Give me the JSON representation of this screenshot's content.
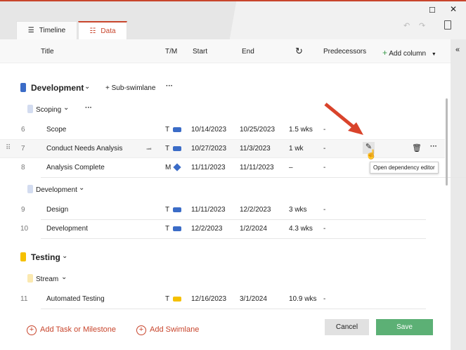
{
  "tabs": [
    {
      "label": "Timeline",
      "icon": "timeline-icon"
    },
    {
      "label": "Data",
      "icon": "list-icon",
      "active": true
    }
  ],
  "columns": {
    "title": "Title",
    "tm": "T/M",
    "start": "Start",
    "end": "End",
    "duration_icon": "history-icon",
    "predecessors": "Predecessors",
    "add_column": "Add column"
  },
  "groups": {
    "development": "Development",
    "sub_swimlane": "Sub-swimlane",
    "scoping": "Scoping",
    "development_sub": "Development",
    "testing": "Testing",
    "stream": "Stream"
  },
  "rows": [
    {
      "num": "6",
      "title": "Scope",
      "tm": "T",
      "start": "10/14/2023",
      "end": "10/25/2023",
      "duration": "1.5 wks",
      "pred": "-"
    },
    {
      "num": "7",
      "title": "Conduct Needs Analysis",
      "tm": "T",
      "start": "10/27/2023",
      "end": "11/3/2023",
      "duration": "1 wk",
      "pred": "-"
    },
    {
      "num": "8",
      "title": "Analysis Complete",
      "tm": "M",
      "start": "11/11/2023",
      "end": "11/11/2023",
      "duration": "–",
      "pred": "-"
    },
    {
      "num": "9",
      "title": "Design",
      "tm": "T",
      "start": "11/11/2023",
      "end": "12/2/2023",
      "duration": "3 wks",
      "pred": "-"
    },
    {
      "num": "10",
      "title": "Development",
      "tm": "T",
      "start": "12/2/2023",
      "end": "1/2/2024",
      "duration": "4.3 wks",
      "pred": "-"
    },
    {
      "num": "11",
      "title": "Automated Testing",
      "tm": "T",
      "start": "12/16/2023",
      "end": "3/1/2024",
      "duration": "10.9 wks",
      "pred": "-"
    }
  ],
  "tooltip": "Open dependency editor",
  "footer": {
    "add_task": "Add Task or Milestone",
    "add_swimlane": "Add Swimlane",
    "cancel": "Cancel",
    "save": "Save"
  },
  "colors": {
    "accent": "#c8452c",
    "development": "#3b6cc7",
    "development_light": "#d3dcf0",
    "testing": "#f5c000",
    "testing_light": "#fbe9b0",
    "save": "#5cb075"
  }
}
